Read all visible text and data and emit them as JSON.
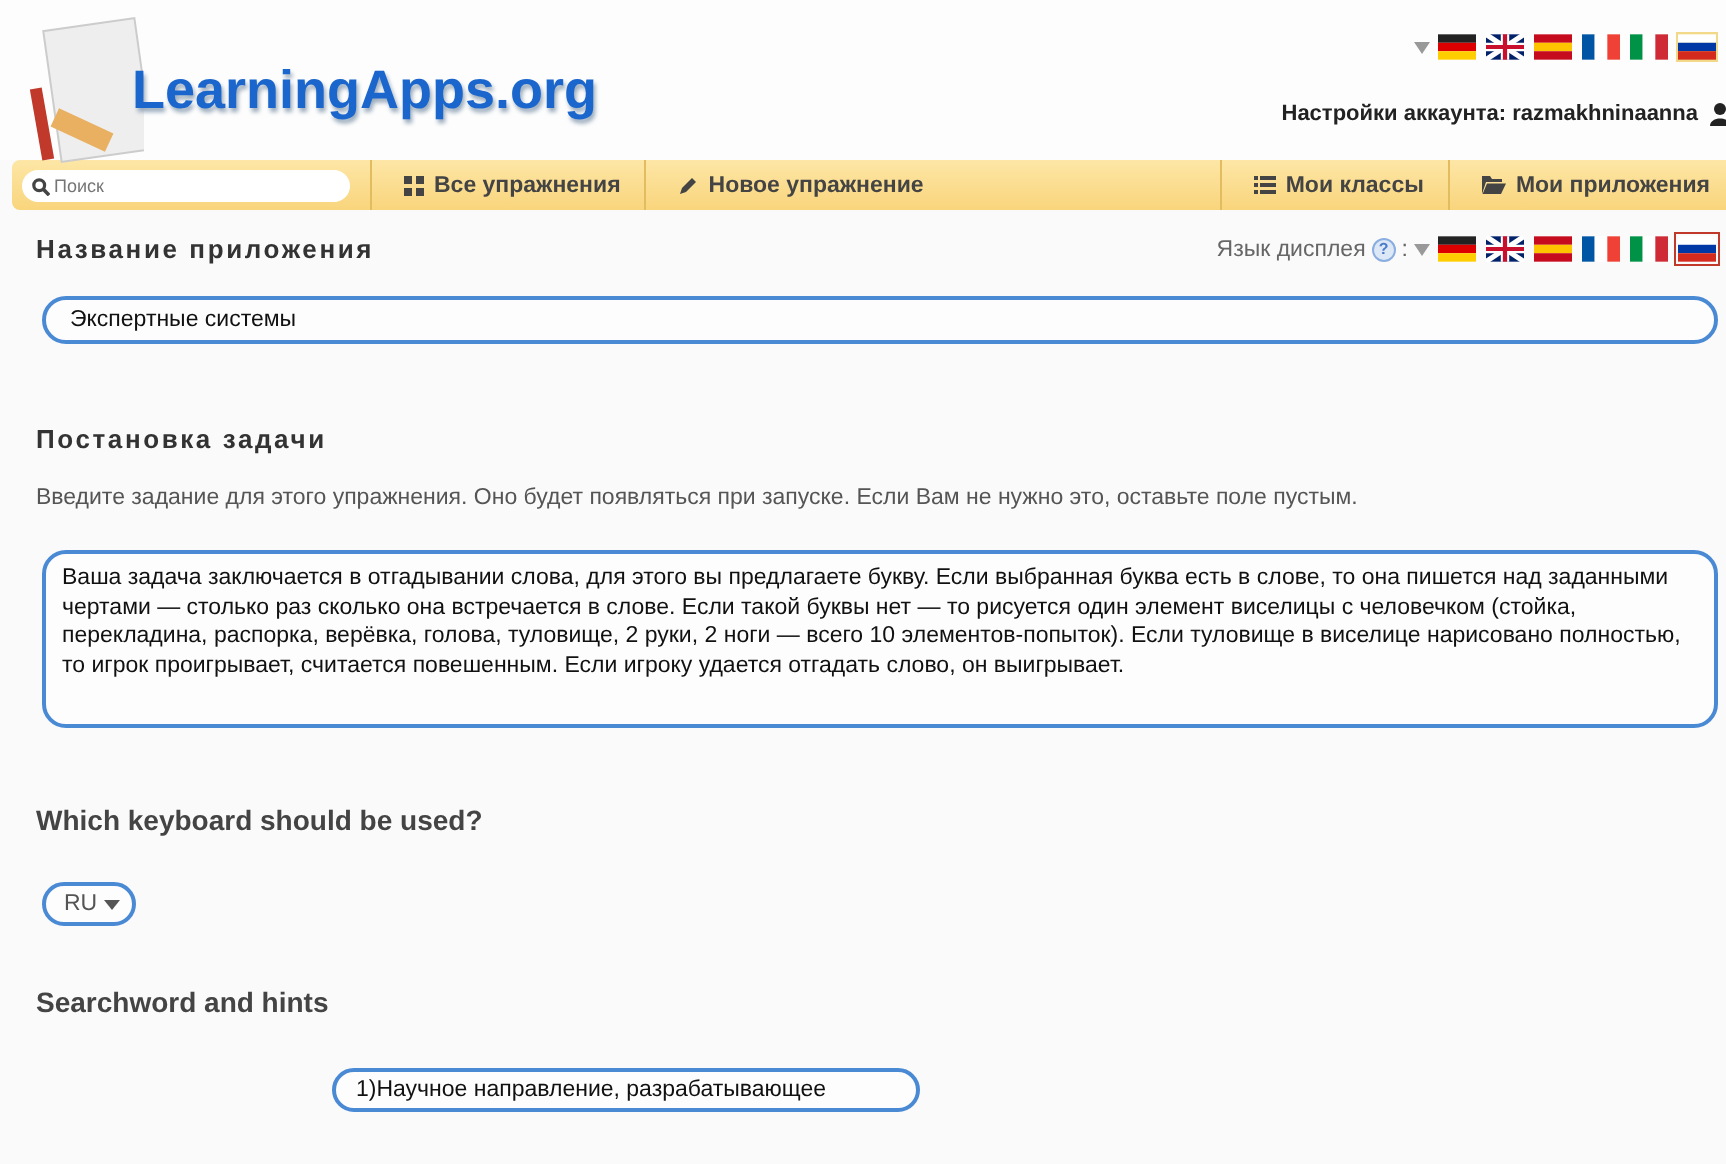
{
  "header": {
    "logo": "LearningApps.org",
    "flags": [
      {
        "kind": "de",
        "selected": false
      },
      {
        "kind": "gb",
        "selected": false
      },
      {
        "kind": "es",
        "selected": false
      },
      {
        "kind": "fr",
        "selected": false
      },
      {
        "kind": "it",
        "selected": false
      },
      {
        "kind": "ru",
        "selected": true
      }
    ],
    "account_label": "Настройки аккаунта:",
    "account_name": "razmakhninaanna"
  },
  "nav": {
    "search": {
      "placeholder": "Поиск"
    },
    "items": [
      {
        "label": "Все упражнения",
        "kind": "grid"
      },
      {
        "label": "Новое упражнение",
        "kind": "pencil"
      },
      {
        "label": "Мои классы",
        "kind": "list"
      },
      {
        "label": "Мои приложения",
        "kind": "folder"
      }
    ]
  },
  "app_name": {
    "heading": "Название приложения",
    "language_label": "Язык дисплея",
    "help": "?",
    "separator": ":",
    "flags": [
      {
        "kind": "de",
        "selected": false
      },
      {
        "kind": "gb",
        "selected": false
      },
      {
        "kind": "es",
        "selected": false
      },
      {
        "kind": "fr",
        "selected": false
      },
      {
        "kind": "it",
        "selected": false
      },
      {
        "kind": "ru",
        "selected": true
      }
    ],
    "value": "Экспертные системы"
  },
  "task": {
    "heading": "Постановка задачи",
    "hint": "Введите задание для этого упражнения. Оно будет появляться при запуске. Если Вам не нужно это, оставьте поле пустым.",
    "value": "Ваша задача заключается в отгадывании слова, для этого вы предлагаете букву. Если выбранная буква есть в слове, то она пишется над заданными чертами — столько раз сколько она встречается в слове. Если такой буквы  нет — то  рисуется один элемент виселицы с человечком (стойка, перекладина, распорка, верёвка, голова, туловище, 2 руки, 2 ноги — всего 10 элементов-попыток). Если туловище в виселице нарисовано полностью, то игрок проигрывает, считается повешенным. Если игроку удается отгадать слово, он выигрывает."
  },
  "keyboard": {
    "heading": "Which keyboard should be used?",
    "value": "RU"
  },
  "searchword": {
    "heading": "Searchword and hints",
    "hint_value": "1)Научное направление, разрабатывающее"
  }
}
